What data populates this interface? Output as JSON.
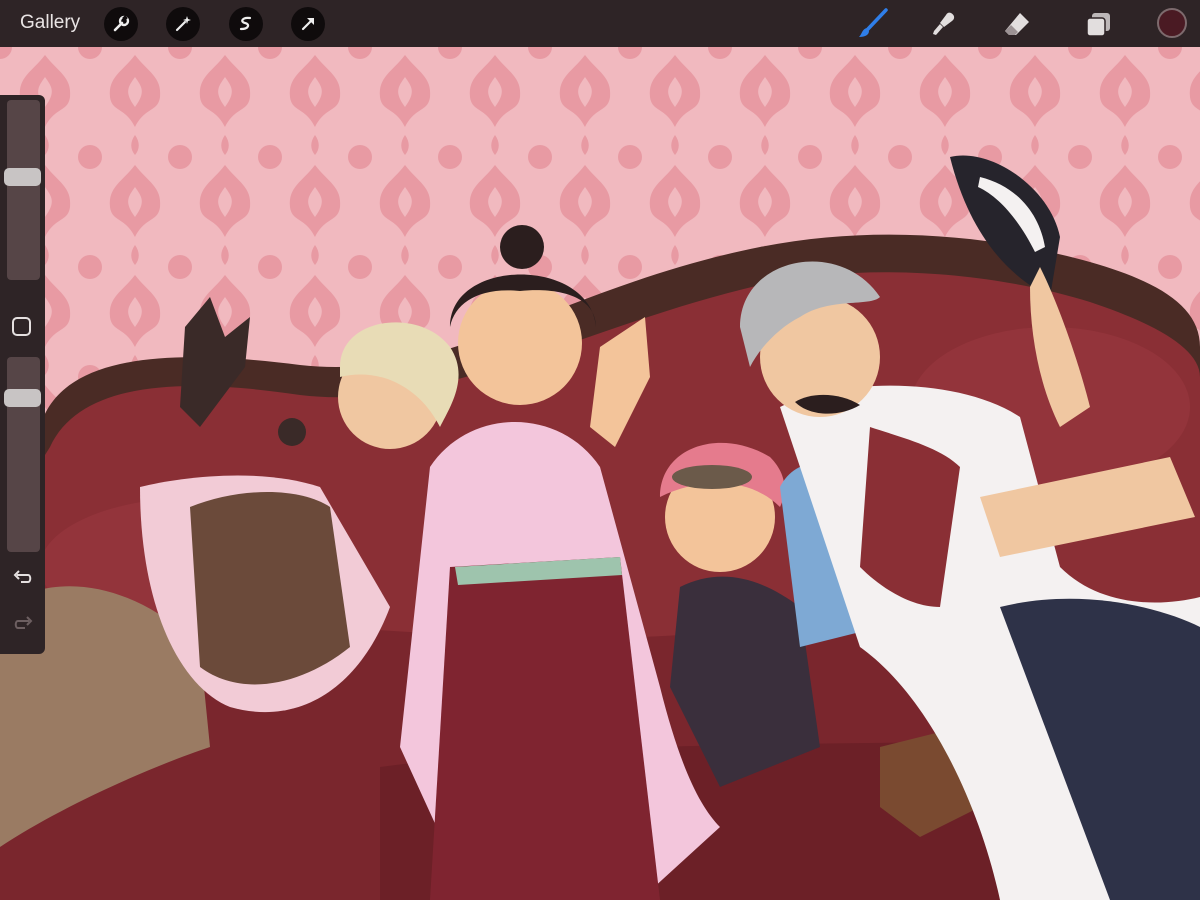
{
  "toolbar": {
    "gallery_label": "Gallery",
    "left_tools": [
      "wrench-icon",
      "magic-wand-icon",
      "selection-icon",
      "transform-arrow-icon"
    ],
    "right_tools": [
      "brush-icon",
      "smudge-icon",
      "eraser-icon",
      "layers-icon"
    ],
    "active_tool": "brush-icon",
    "active_tool_color": "#2f7ee8",
    "current_color": "#4a1a23"
  },
  "sidebar": {
    "size_slider_level": 0.58,
    "opacity_slider_level": 0.82,
    "buttons": [
      "modify-button",
      "undo-icon",
      "redo-icon"
    ]
  },
  "canvas": {
    "content": "illustration",
    "wallpaper_color": "#f1b9bf",
    "wallpaper_pattern_color": "#e89aa3",
    "sofa_color": "#7a2a2e"
  }
}
